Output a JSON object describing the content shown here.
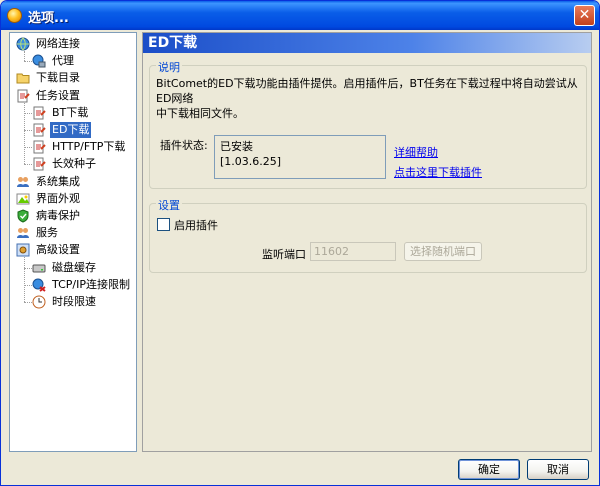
{
  "window": {
    "title": "选项..."
  },
  "tree": [
    {
      "id": "network",
      "label": "网络连接",
      "icon": "network-globe-icon",
      "level": 0
    },
    {
      "id": "proxy",
      "label": "代理",
      "icon": "proxy-icon",
      "level": 1
    },
    {
      "id": "download-dir",
      "label": "下载目录",
      "icon": "folder-icon",
      "level": 0
    },
    {
      "id": "task-settings",
      "label": "任务设置",
      "icon": "task-icon",
      "level": 0
    },
    {
      "id": "bt-download",
      "label": "BT下载",
      "icon": "task-icon",
      "level": 1
    },
    {
      "id": "ed-download",
      "label": "ED下载",
      "icon": "task-icon",
      "level": 1,
      "selected": true
    },
    {
      "id": "http-ftp",
      "label": "HTTP/FTP下载",
      "icon": "task-icon",
      "level": 1
    },
    {
      "id": "seed",
      "label": "长效种子",
      "icon": "task-icon",
      "level": 1
    },
    {
      "id": "integration",
      "label": "系统集成",
      "icon": "users-icon",
      "level": 0
    },
    {
      "id": "appearance",
      "label": "界面外观",
      "icon": "appearance-icon",
      "level": 0
    },
    {
      "id": "antivirus",
      "label": "病毒保护",
      "icon": "shield-icon",
      "level": 0
    },
    {
      "id": "service",
      "label": "服务",
      "icon": "users-icon",
      "level": 0
    },
    {
      "id": "advanced",
      "label": "高级设置",
      "icon": "advanced-icon",
      "level": 0
    },
    {
      "id": "disk-cache",
      "label": "磁盘缓存",
      "icon": "disk-icon",
      "level": 1
    },
    {
      "id": "tcp-limit",
      "label": "TCP/IP连接限制",
      "icon": "tcp-icon",
      "level": 1
    },
    {
      "id": "time-limit",
      "label": "时段限速",
      "icon": "clock-icon",
      "level": 1
    }
  ],
  "panel": {
    "title": "ED下载",
    "description": {
      "legend": "说明",
      "text_line1": "BitComet的ED下载功能由插件提供。启用插件后，BT任务在下载过程中将自动尝试从ED网络",
      "text_line2": "中下载相同文件。",
      "status_label": "插件状态:",
      "status_line1": "已安装",
      "status_line2": "[1.03.6.25]",
      "help_link": "详细帮助",
      "download_link": "点击这里下载插件"
    },
    "settings": {
      "legend": "设置",
      "enable_label": "启用插件",
      "enabled": false,
      "port_label": "监听端口",
      "port_value": "11602",
      "random_port_button": "选择随机端口"
    }
  },
  "footer": {
    "ok_label": "确定",
    "cancel_label": "取消"
  }
}
